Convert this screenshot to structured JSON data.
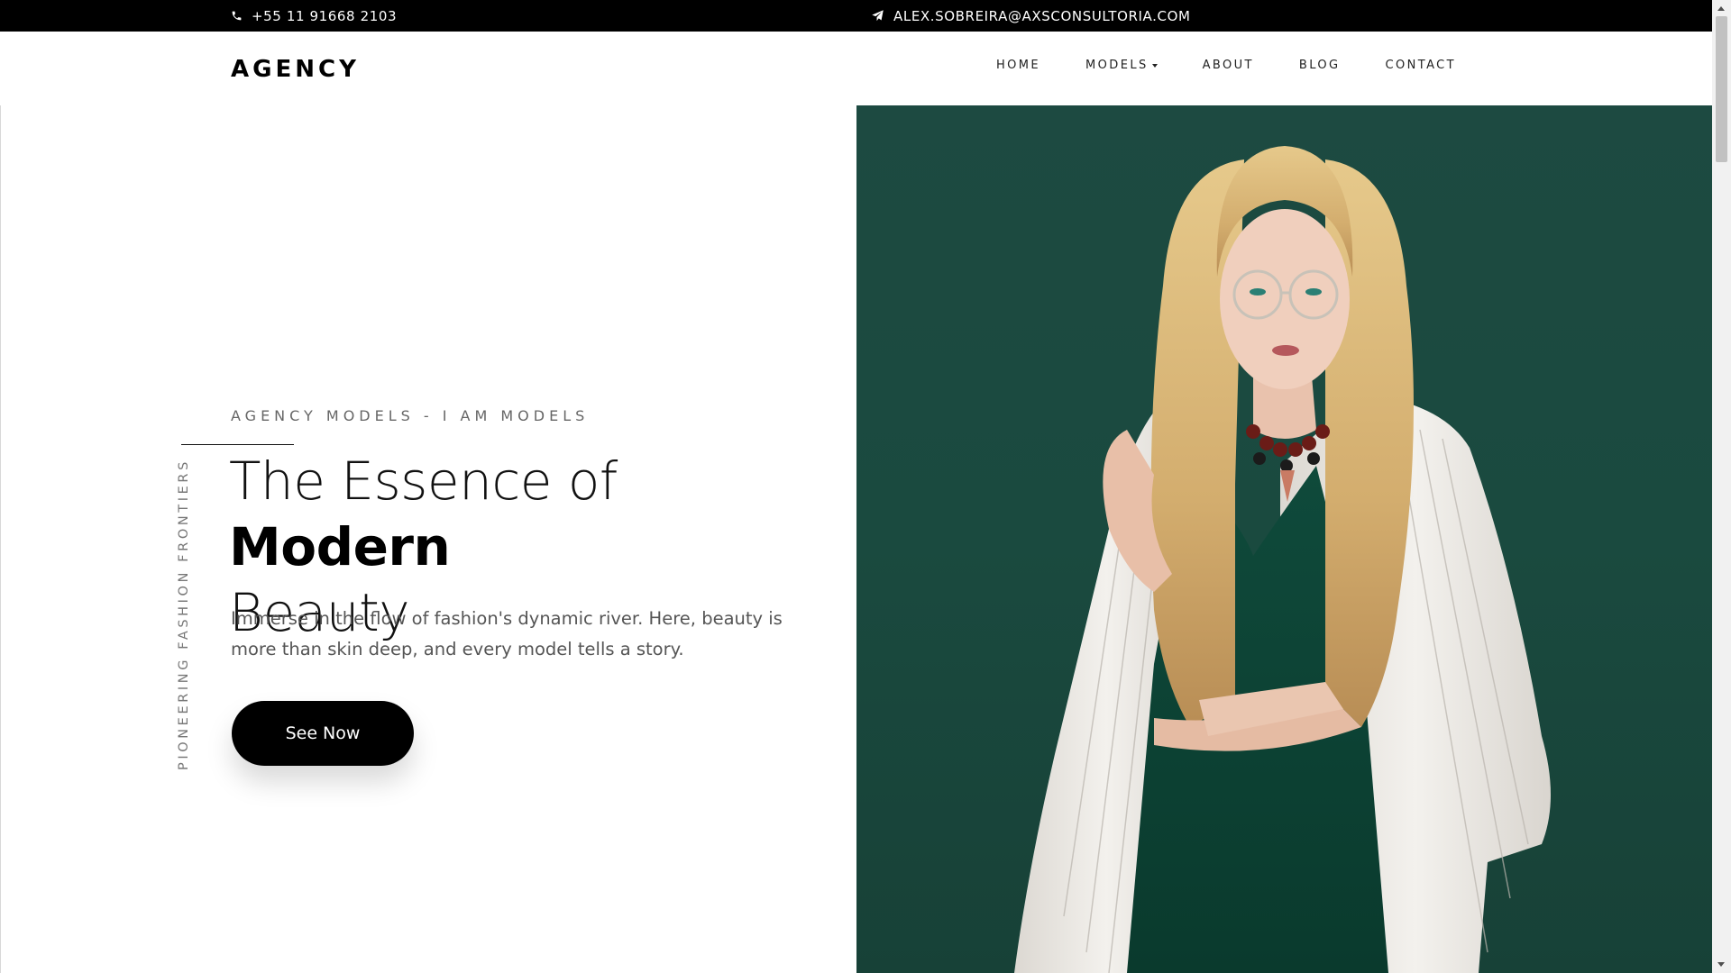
{
  "topbar": {
    "phone_icon": "phone-icon",
    "phone": "+55 11 91668 2103",
    "email_icon": "paper-plane-icon",
    "email": "ALEX.SOBREIRA@AXSCONSULTORIA.COM",
    "background": "#000000"
  },
  "header": {
    "logo": "AGENCY",
    "nav": [
      {
        "label": "HOME"
      },
      {
        "label": "MODELS",
        "dropdown": true
      },
      {
        "label": "ABOUT"
      },
      {
        "label": "BLOG"
      },
      {
        "label": "CONTACT"
      }
    ]
  },
  "hero": {
    "side_tag": "PIONEERING FASHION FRONTIERS",
    "eyebrow": "AGENCY MODELS - I AM MODELS",
    "headline_pre": "The Essence of ",
    "headline_bold": "Modern",
    "headline_post": "Beauty",
    "lead": "Immerse in the flow of fashion's dynamic river. Here, beauty is more than skin deep, and every model tells a story.",
    "cta": "See Now",
    "image_alt": "model in green dress with white striped blazer and glasses",
    "image_bg": "#1d4a41"
  }
}
